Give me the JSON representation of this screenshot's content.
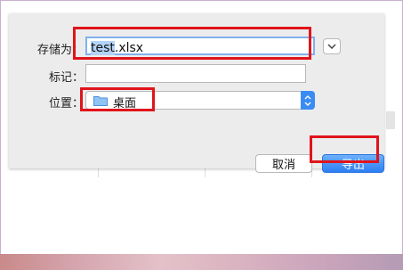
{
  "dialog": {
    "save_as_label": "存储为：",
    "filename_value": "test.xlsx",
    "filename_selected": "test",
    "filename_rest": ".xlsx",
    "tags_label": "标记：",
    "tags_value": "",
    "location_label": "位置：",
    "location_value": "桌面",
    "cancel_label": "取消",
    "export_label": "导出"
  },
  "colors": {
    "highlight": "#e0141b",
    "accent": "#3a8cf5"
  }
}
